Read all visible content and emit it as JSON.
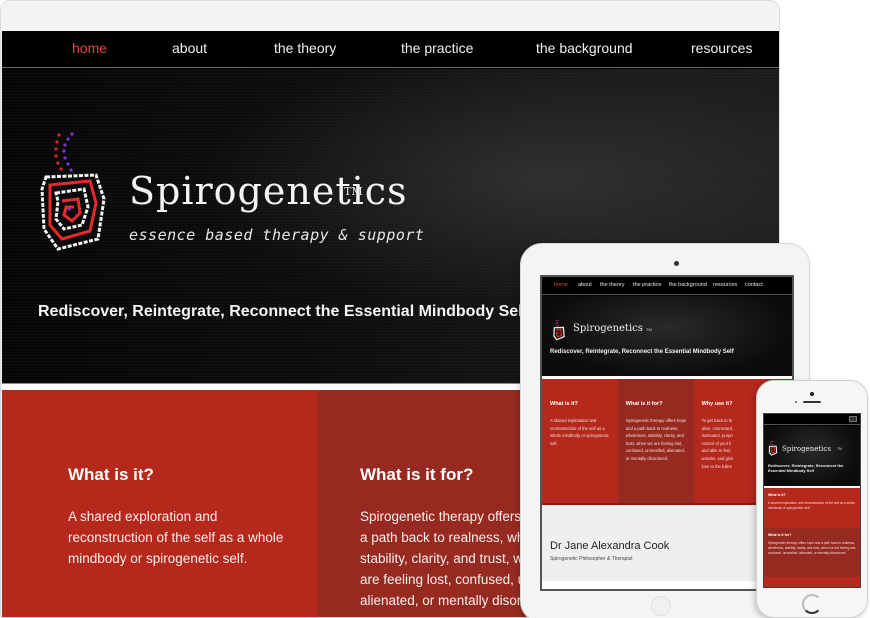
{
  "desktop": {
    "nav": {
      "items": [
        {
          "label": "home",
          "active": true
        },
        {
          "label": "about",
          "active": false
        },
        {
          "label": "the theory",
          "active": false
        },
        {
          "label": "the practice",
          "active": false
        },
        {
          "label": "the background",
          "active": false
        },
        {
          "label": "resources",
          "active": false
        }
      ]
    },
    "hero": {
      "brand_name": "Spirogenetics",
      "trademark": "TM",
      "tagline": "essence based therapy & support",
      "slogan": "Rediscover, Reintegrate, Reconnect the Essential Mindbody Self"
    },
    "columns": [
      {
        "title": "What is it?",
        "text": "A shared exploration and reconstruction of the self as a whole mindbody or spirogenetic self."
      },
      {
        "title": "What is it for?",
        "text_lines": [
          "Spirogenetic therapy offers hope and",
          "a path back to realness, wholeness,",
          "stability, clarity, and trust, when we",
          "are feeling lost, confused, unravelled,",
          "alienated, or mentally disordered."
        ]
      }
    ]
  },
  "tablet": {
    "nav": [
      "home",
      "about",
      "the theory",
      "the practice",
      "the background",
      "resources",
      "contact"
    ],
    "brand_name": "Spirogenetics",
    "trademark": "TM",
    "slogan": "Rediscover, Reintegrate, Reconnect the Essential Mindbody Self",
    "columns": [
      {
        "title": "What is it?",
        "text": "A shared exploration and reconstruction of the self as a whole mindbody or spirogenetic self."
      },
      {
        "title": "What is it for?",
        "text": "Spirogenetic therapy offers hope and a path back to realness, wholeness, stability, clarity, and trust, when we are feeling lost, confused, unravelled, alienated, or mentally disordered."
      },
      {
        "title": "Why use it?",
        "text": "To get back to fe\nalive, connected,\nmotivated, purpo\ncontrol of your li\nand able to feel,\nwonder, and glim\nlove to the fulles"
      }
    ],
    "bio": {
      "name": "Dr Jane Alexandra Cook",
      "role": "Spirogenetic Philosopher & Therapist"
    }
  },
  "phone": {
    "brand_name": "Spirogenetics",
    "trademark": "TM",
    "slogan": "Rediscover, Reintegrate, Reconnect the Essential Mindbody Self",
    "sections": [
      {
        "title": "What is it?",
        "text": "A shared exploration and reconstruction of the self as a whole mindbody or spirogenetic self."
      },
      {
        "title": "What is it for?",
        "text": "Spirogenetic therapy offers hope and a path back to realness, wholeness, stability, clarity, and trust, when we are feeling lost, confused, unravelled, alienated, or mentally disordered."
      }
    ]
  },
  "colors": {
    "accent_red": "#b5281c",
    "dark_red": "#962a20",
    "nav_active": "#e0473c",
    "hero_bg": "#0b0b0b"
  }
}
